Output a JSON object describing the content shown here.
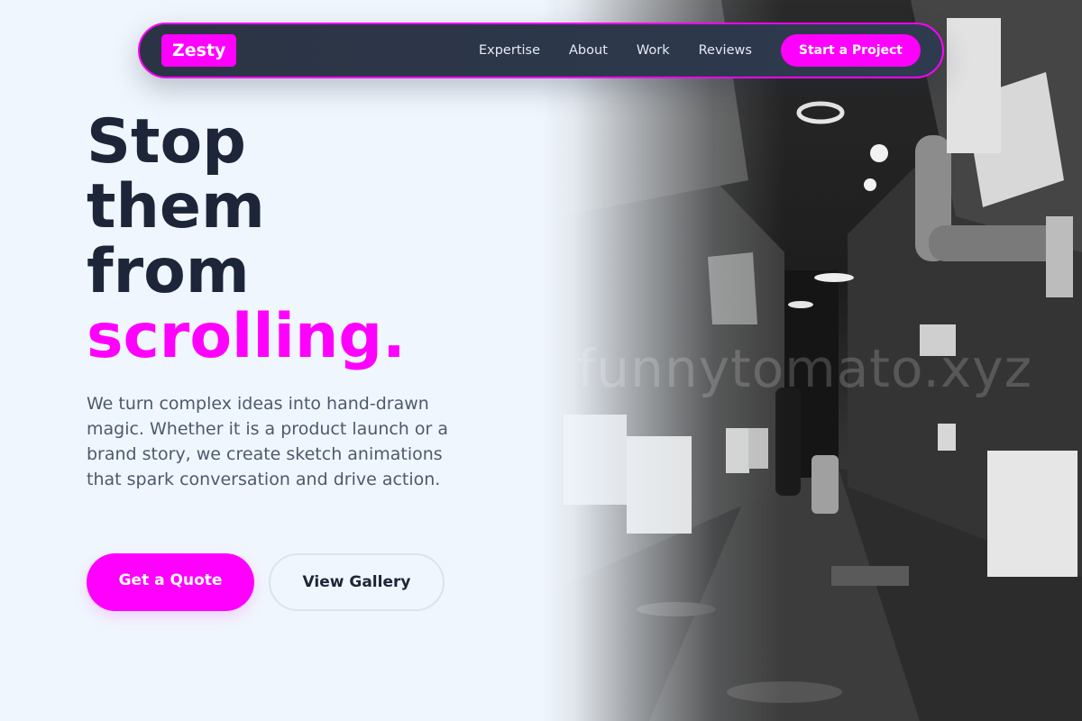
{
  "nav": {
    "logo": "Zesty",
    "links": [
      "Expertise",
      "About",
      "Work",
      "Reviews"
    ],
    "cta": "Start a Project"
  },
  "hero": {
    "headline_lines": [
      "Stop",
      "them",
      "from"
    ],
    "headline_accent": "scrolling.",
    "description": "We turn complex ideas into hand-drawn magic. Whether it is a product launch or a brand story, we create sketch animations that spark conversation and drive action.",
    "primary_button": "Get a Quote",
    "secondary_button": "View Gallery"
  },
  "image": {
    "subject": "black-and-white-narrow-alley-photo",
    "watermark": "funnytomato.xyz"
  },
  "colors": {
    "accent": "#ff00ff",
    "heading": "#1d2638",
    "body_text": "#4d5a6c",
    "page_bg": "#f0f6fd",
    "nav_bg": "#2b3445"
  }
}
